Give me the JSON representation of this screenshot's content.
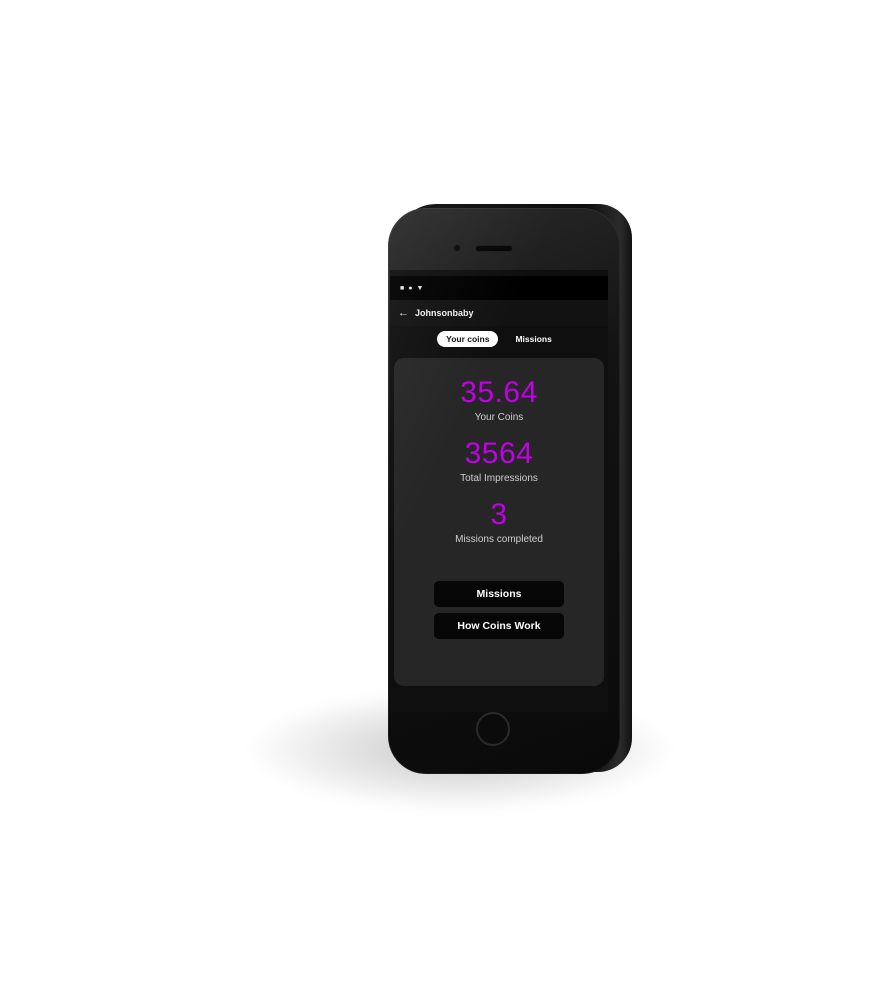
{
  "colors": {
    "accent": "#c100e6",
    "screen_bg": "#0f0f0f",
    "card_bg": "#262626",
    "button_bg": "#060606"
  },
  "status_bar": {
    "icons": [
      "stop-icon",
      "record-icon",
      "signal-icon"
    ]
  },
  "app_bar": {
    "back_icon": "arrow-left-icon",
    "title": "Johnsonbaby"
  },
  "tabs": [
    {
      "label": "Your coins",
      "active": true
    },
    {
      "label": "Missions",
      "active": false
    }
  ],
  "stats": [
    {
      "value": "35.64",
      "label": "Your Coins"
    },
    {
      "value": "3564",
      "label": "Total Impressions"
    },
    {
      "value": "3",
      "label": "Missions completed"
    }
  ],
  "buttons": {
    "missions": "Missions",
    "how_coins_work": "How Coins Work"
  }
}
